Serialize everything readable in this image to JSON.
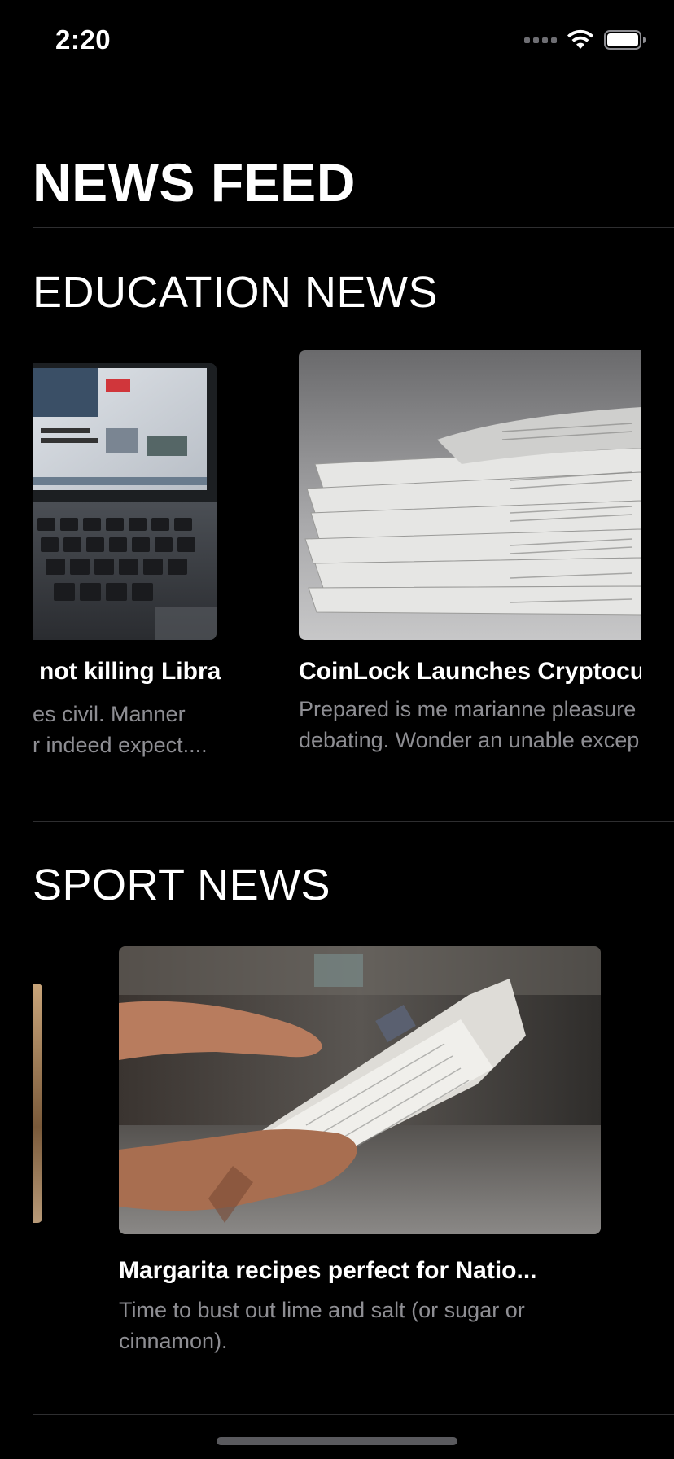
{
  "status_bar": {
    "time": "2:20",
    "icons": [
      "signal-icon",
      "wifi-icon",
      "battery-icon"
    ]
  },
  "page": {
    "title": "NEWS FEED"
  },
  "sections": [
    {
      "title": "EDUCATION NEWS",
      "cards": [
        {
          "image": "laptop-news-photo",
          "title": "not killing Libra",
          "desc_line1": "es civil. Manner",
          "desc_line2": "r indeed expect...."
        },
        {
          "image": "newspaper-stack-photo",
          "title": "CoinLock Launches Cryptocu",
          "desc_line1": "Prepared is me marianne pleasure",
          "desc_line2": "debating. Wonder an unable excep"
        }
      ]
    },
    {
      "title": "SPORT NEWS",
      "cards": [
        {
          "image": "partial-card-photo",
          "title": "",
          "desc_line1": "",
          "desc_line2": ""
        },
        {
          "image": "hands-holding-newspaper-photo",
          "title": "Margarita recipes perfect for Natio...",
          "desc_line1": "Time to bust out lime and salt (or sugar or",
          "desc_line2": "cinnamon)."
        }
      ]
    }
  ],
  "colors": {
    "background": "#000000",
    "text_primary": "#ffffff",
    "text_secondary": "#8e8e93",
    "divider": "#2e2e30"
  }
}
